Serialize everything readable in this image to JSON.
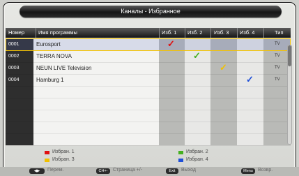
{
  "title": "Каналы - Избранное",
  "columns": {
    "number": "Номер",
    "name": "Имя программы",
    "fav1": "Изб. 1",
    "fav2": "Изб. 2",
    "fav3": "Изб. 3",
    "fav4": "Изб. 4",
    "type": "Тип"
  },
  "rows": [
    {
      "number": "0001",
      "name": "Eurosport",
      "type": "TV",
      "fav": 1
    },
    {
      "number": "0002",
      "name": "TERRA NOVA",
      "type": "TV",
      "fav": 2
    },
    {
      "number": "0003",
      "name": "NEUN LIVE Television",
      "type": "TV",
      "fav": 3
    },
    {
      "number": "0004",
      "name": "Hamburg 1",
      "type": "TV",
      "fav": 4
    }
  ],
  "check_glyph": "✓",
  "legend": [
    {
      "label": "Избран. 1",
      "color": "#e01010"
    },
    {
      "label": "Избран. 2",
      "color": "#45b020"
    },
    {
      "label": "Избран. 3",
      "color": "#f0c000"
    },
    {
      "label": "Избран. 4",
      "color": "#1f4fd8"
    }
  ],
  "footer": {
    "k1_key": "◀▶",
    "k1_label": "Перем.",
    "k2_key": "CH+-",
    "k2_label": "Страница +/-",
    "k3_key": "Exit",
    "k3_label": "Выход",
    "k4_key": "Menu",
    "k4_label": "Возвр."
  }
}
